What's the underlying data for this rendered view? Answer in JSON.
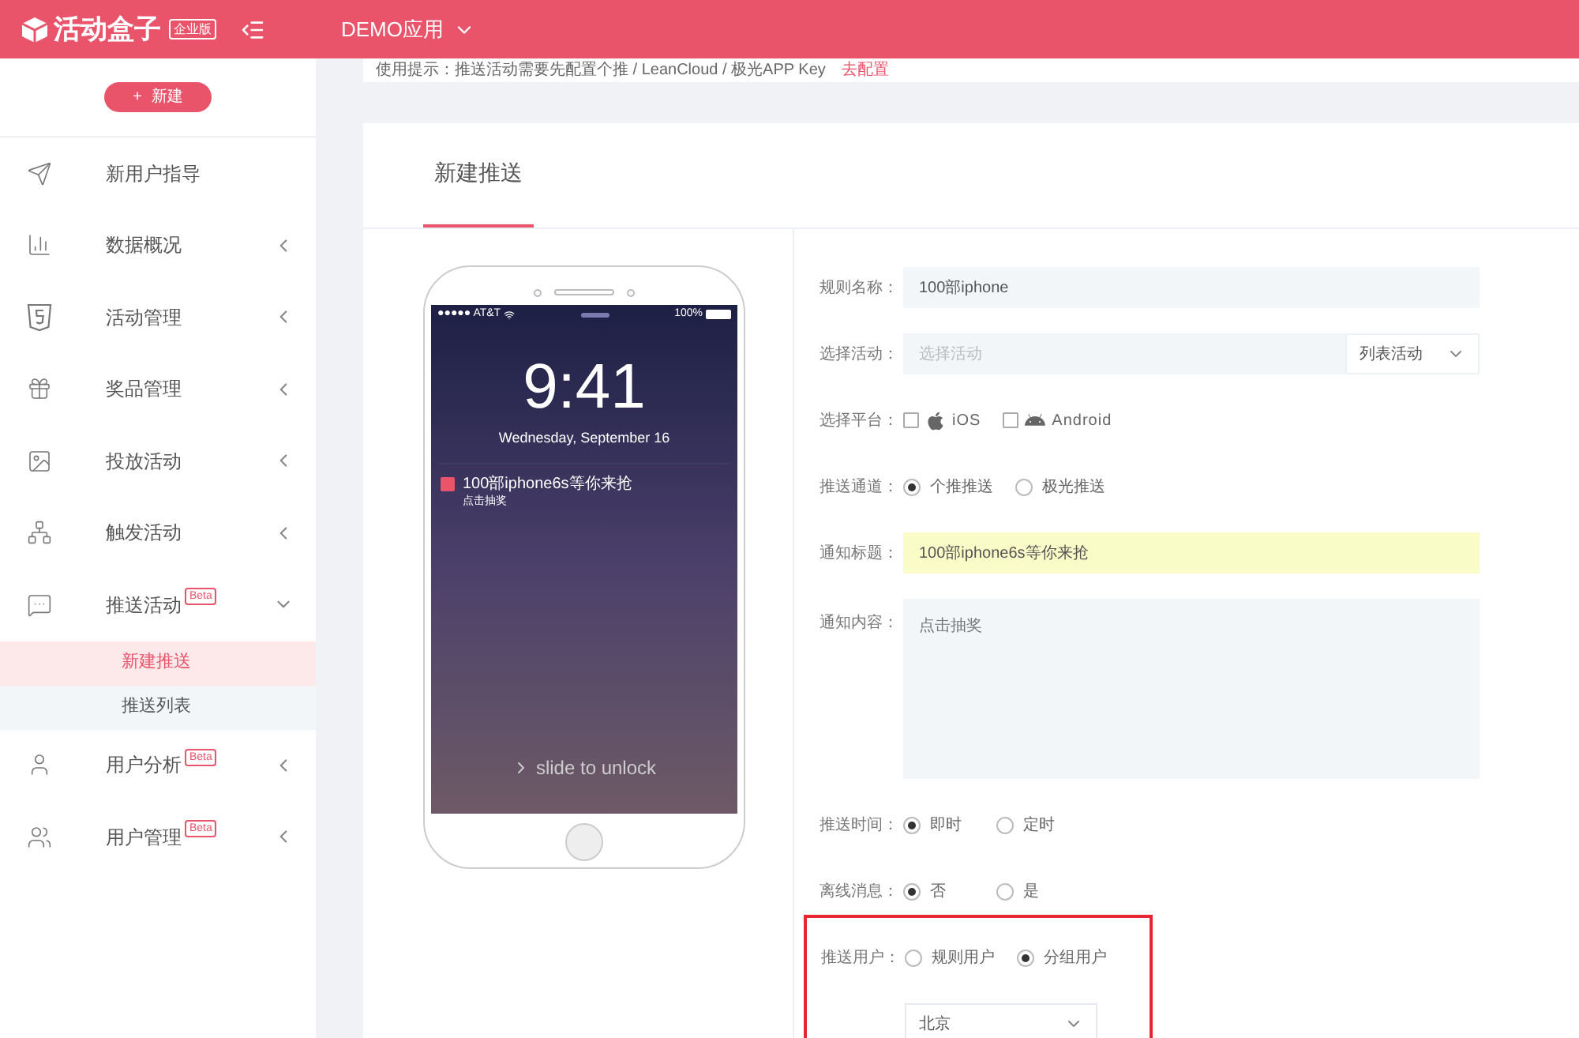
{
  "header": {
    "logo_text": "活动盒子",
    "edition": "企业版",
    "app_name": "DEMO应用"
  },
  "hint": {
    "text": "使用提示：推送活动需要先配置个推 / LeanCloud / 极光APP Key",
    "link": "去配置"
  },
  "sidebar": {
    "new_button": {
      "icon": "+",
      "label": "新建"
    },
    "items": [
      {
        "label": "新用户指导",
        "kind": "link"
      },
      {
        "label": "数据概况",
        "kind": "group",
        "expanded": false
      },
      {
        "label": "活动管理",
        "kind": "group",
        "expanded": false
      },
      {
        "label": "奖品管理",
        "kind": "group",
        "expanded": false
      },
      {
        "label": "投放活动",
        "kind": "group",
        "expanded": false
      },
      {
        "label": "触发活动",
        "kind": "group",
        "expanded": false
      },
      {
        "label": "推送活动",
        "kind": "group",
        "badge": "Beta",
        "expanded": true,
        "children": [
          {
            "label": "新建推送",
            "selected": true
          },
          {
            "label": "推送列表",
            "selected": false
          }
        ]
      },
      {
        "label": "用户分析",
        "kind": "group",
        "badge": "Beta",
        "expanded": false
      },
      {
        "label": "用户管理",
        "kind": "group",
        "badge": "Beta",
        "expanded": false
      }
    ]
  },
  "tabs": [
    {
      "label": "新建推送",
      "selected": true
    }
  ],
  "phone": {
    "carrier": "●●●●● AT&T",
    "battery": "100%",
    "time": "9:41",
    "date": "Wednesday, September 16",
    "notification": {
      "title": "100部iphone6s等你来抢",
      "body": "点击抽奖"
    },
    "unlock": "slide to unlock"
  },
  "form": [
    {
      "kind": "text",
      "label": "规则名称：",
      "value": "100部iphone",
      "highlighted": false
    },
    {
      "kind": "combo",
      "label": "选择活动：",
      "placeholder": "选择活动",
      "select": "列表活动"
    },
    {
      "kind": "checks",
      "label": "选择平台：",
      "options": [
        {
          "label": "iOS",
          "checked": false
        },
        {
          "label": "Android",
          "checked": false
        }
      ]
    },
    {
      "kind": "radios",
      "label": "推送通道：",
      "options": [
        {
          "label": "个推推送",
          "selected": true
        },
        {
          "label": "极光推送",
          "selected": false
        }
      ]
    },
    {
      "kind": "text",
      "label": "通知标题：",
      "value": "100部iphone6s等你来抢",
      "highlighted": true
    },
    {
      "kind": "textarea",
      "label": "通知内容：",
      "value": "点击抽奖"
    },
    {
      "kind": "radios",
      "label": "推送时间：",
      "options": [
        {
          "label": "即时",
          "selected": true
        },
        {
          "label": "定时",
          "selected": false
        }
      ]
    },
    {
      "kind": "radios",
      "label": "离线消息：",
      "options": [
        {
          "label": "否",
          "selected": true
        },
        {
          "label": "是",
          "selected": false
        }
      ]
    },
    {
      "kind": "radios",
      "label": "推送用户：",
      "framed": true,
      "options": [
        {
          "label": "规则用户",
          "selected": false
        },
        {
          "label": "分组用户",
          "selected": true
        }
      ]
    },
    {
      "kind": "select",
      "value": "北京",
      "framed": true
    }
  ]
}
